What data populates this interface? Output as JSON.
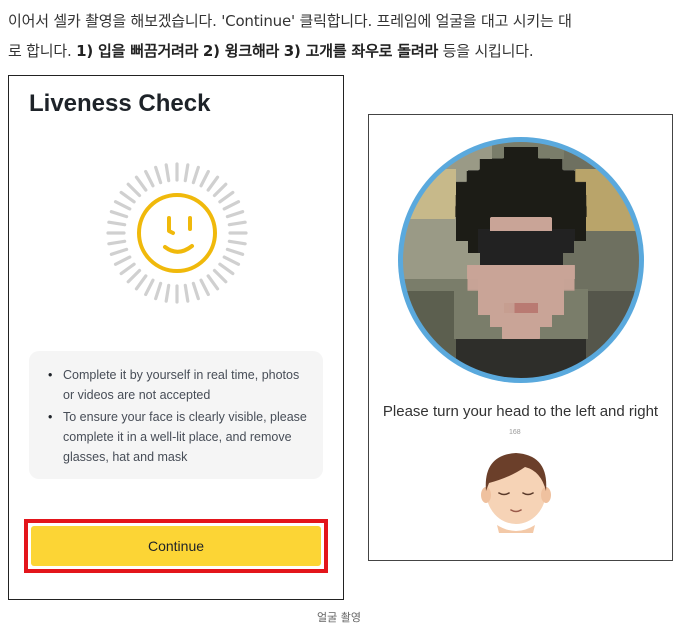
{
  "article": {
    "line1": "이어서 셀카 촬영을 해보겠습니다. 'Continue' 클릭합니다. 프레임에 얼굴을 대고 시키는 대",
    "line2_start": "로 합니다. ",
    "step1": "1) 입을 뻐끔거려라",
    "step2": "2) 윙크해라",
    "step3": "3) 고개를 좌우로 돌려라",
    "line2_end": " 등을 시킵니다.",
    "caption": "얼굴 촬영"
  },
  "liveness": {
    "title": "Liveness Check",
    "bullets": [
      "Complete it by yourself in real time, photos or videos are not accepted",
      "To ensure your face is clearly visible, please complete it in a well-lit place, and remove glasses, hat and mask"
    ],
    "continue_label": "Continue",
    "colors": {
      "accent": "#fcd535",
      "highlight_border": "#e3151b",
      "face": "#f0b90b"
    }
  },
  "capture": {
    "instruction": "Please turn your head to the left and right",
    "small_text": "168"
  }
}
